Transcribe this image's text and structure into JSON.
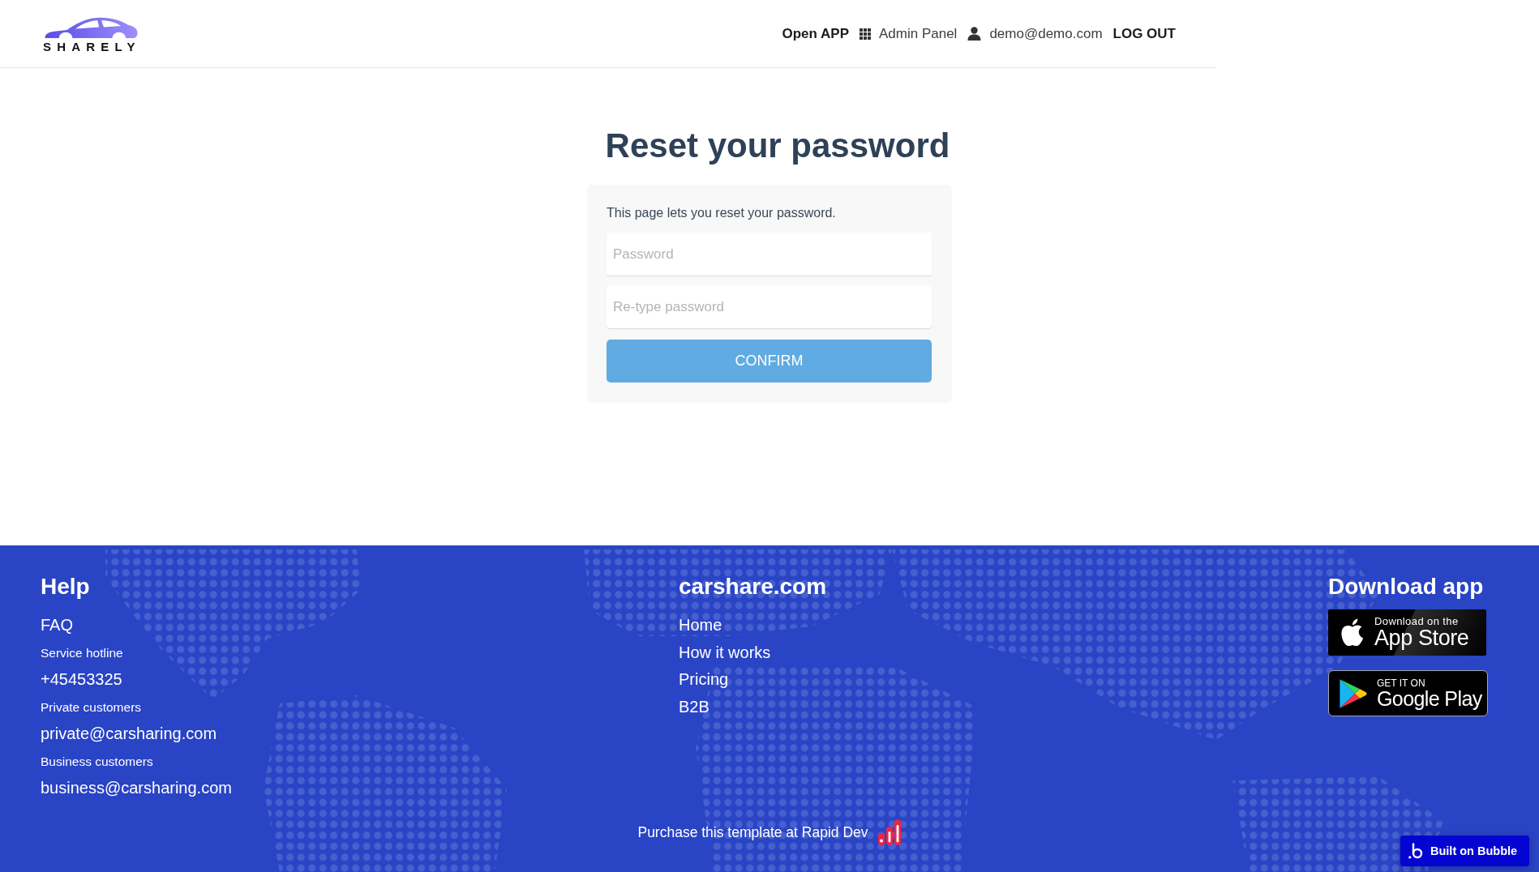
{
  "header": {
    "logo_text": "SHARELY",
    "nav": [
      {
        "kind": "link",
        "label": "Open APP"
      },
      {
        "kind": "grid",
        "label": "Admin Panel"
      },
      {
        "kind": "user",
        "label": "demo@demo.com"
      },
      {
        "kind": "link",
        "label": "LOG OUT"
      }
    ]
  },
  "reset_form": {
    "title": "Reset your password",
    "description": "This page lets you reset your password.",
    "fields": [
      {
        "placeholder": "Password"
      },
      {
        "placeholder": "Re-type password"
      }
    ],
    "button": "CONFIRM"
  },
  "footer": {
    "columns": [
      {
        "title": "Help",
        "items": [
          {
            "kind": "link",
            "text": "FAQ"
          },
          {
            "kind": "label",
            "text": "Service hotline"
          },
          {
            "kind": "link",
            "text": "+45453325"
          },
          {
            "kind": "label",
            "text": "Private customers"
          },
          {
            "kind": "link",
            "text": "private@carsharing.com"
          },
          {
            "kind": "label",
            "text": "Business customers"
          },
          {
            "kind": "link",
            "text": "business@carsharing.com"
          }
        ]
      },
      {
        "title": "carshare.com",
        "items": [
          {
            "kind": "link",
            "text": "Home"
          },
          {
            "kind": "link",
            "text": "How it works"
          },
          {
            "kind": "link",
            "text": "Pricing"
          },
          {
            "kind": "link",
            "text": "B2B"
          }
        ]
      },
      {
        "title": "Download app",
        "badges": [
          {
            "kind": "app_store",
            "small_text": "Download on the",
            "large_text": "App Store"
          },
          {
            "kind": "google_play",
            "small_text": "GET IT ON",
            "large_text": "Google Play"
          }
        ]
      }
    ],
    "purchase_note": "Purchase this template at Rapid Dev",
    "built_badge": "Built on Bubble"
  }
}
